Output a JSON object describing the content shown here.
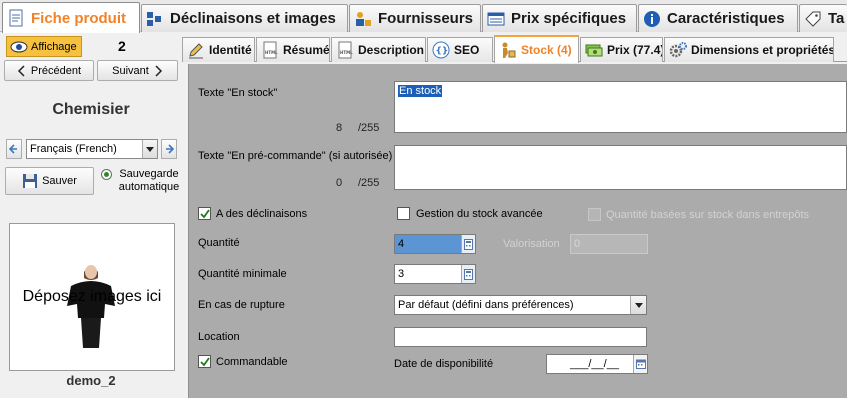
{
  "top_tabs": [
    {
      "label": "Fiche produit",
      "icon": "document-icon",
      "active": true
    },
    {
      "label": "Déclinaisons et images",
      "icon": "combinations-icon",
      "active": false
    },
    {
      "label": "Fournisseurs",
      "icon": "supplier-icon",
      "active": false
    },
    {
      "label": "Prix spécifiques",
      "icon": "price-list-icon",
      "active": false
    },
    {
      "label": "Caractéristiques",
      "icon": "info-icon",
      "active": false
    },
    {
      "label": "Ta",
      "icon": "tag-icon",
      "active": false
    }
  ],
  "left": {
    "affichage_label": "Affichage",
    "count": "2",
    "prev_label": "Précédent",
    "next_label": "Suivant",
    "product_name": "Chemisier",
    "language": "Français (French)",
    "save_label": "Sauver",
    "autosave_label": "Sauvegarde automatique",
    "drop_text": "Déposez images ici",
    "image_name": "demo_2"
  },
  "sub_tabs": [
    {
      "label": "Identité",
      "icon": "pencil-icon",
      "active": false
    },
    {
      "label": "Résumé",
      "icon": "html-icon",
      "active": false
    },
    {
      "label": "Description",
      "icon": "html-icon",
      "active": false
    },
    {
      "label": "SEO",
      "icon": "braces-icon",
      "active": false
    },
    {
      "label": "Stock (4)",
      "icon": "stock-icon",
      "active": true
    },
    {
      "label": "Prix (77.4)",
      "icon": "money-icon",
      "active": false
    },
    {
      "label": "Dimensions et propriétés",
      "icon": "gear-icon",
      "active": false
    }
  ],
  "stock": {
    "in_stock_label": "Texte \"En stock\"",
    "in_stock_value": "En stock",
    "in_stock_count": "8",
    "in_stock_max": "/255",
    "preorder_label": "Texte \"En pré-commande\" (si autorisée)",
    "preorder_value": "",
    "preorder_count": "0",
    "preorder_max": "/255",
    "has_combinations_label": "A des déclinaisons",
    "has_combinations_checked": true,
    "advanced_stock_label": "Gestion du stock avancée",
    "advanced_stock_checked": false,
    "warehouse_qty_label": "Quantité basées sur stock dans entrepôts",
    "warehouse_qty_checked": false,
    "quantity_label": "Quantité",
    "quantity_value": "4",
    "valuation_label": "Valorisation",
    "valuation_value": "0",
    "min_qty_label": "Quantité minimale",
    "min_qty_value": "3",
    "out_of_stock_label": "En cas de rupture",
    "out_of_stock_value": "Par défaut (défini dans préférences)",
    "location_label": "Location",
    "location_value": "",
    "orderable_label": "Commandable",
    "orderable_checked": true,
    "availability_date_label": "Date de disponibilité",
    "availability_date_value": "___/__/__"
  }
}
